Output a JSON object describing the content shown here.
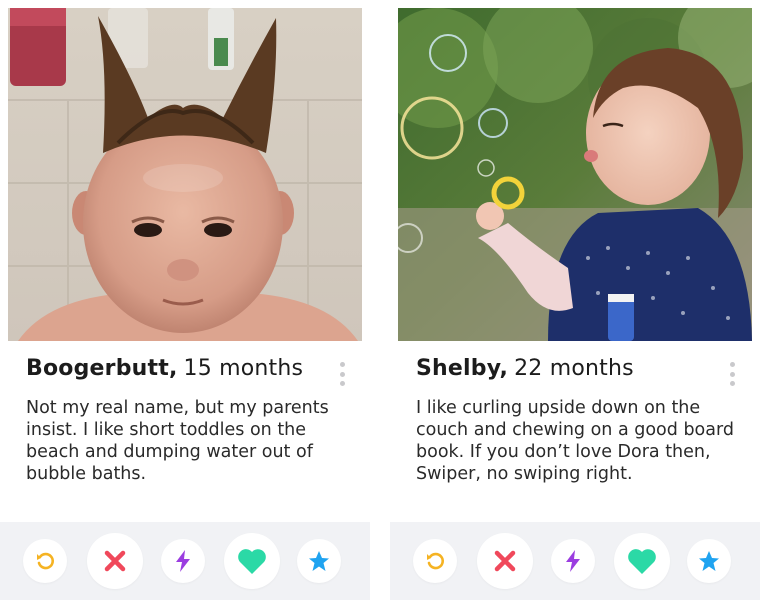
{
  "cards": [
    {
      "name": "Boogerbutt,",
      "age": "15 months",
      "bio": "Not my real name, but my parents insist. I like short toddles on the beach and dumping water out of bubble baths.",
      "photo_subject": "wet-haired-baby"
    },
    {
      "name": "Shelby,",
      "age": "22 months",
      "bio": "I like curling upside down on the couch and chewing on a good board book. If you don’t love Dora then, Swiper, no swiping right.",
      "photo_subject": "girl-blowing-bubbles"
    }
  ],
  "actions": [
    {
      "icon": "rewind-icon",
      "color": "#f5b323"
    },
    {
      "icon": "nope-icon",
      "color": "#f0485b"
    },
    {
      "icon": "boost-icon",
      "color": "#9b3de0"
    },
    {
      "icon": "like-icon",
      "color": "#2bd9a6"
    },
    {
      "icon": "super-like-icon",
      "color": "#1fa3f0"
    }
  ],
  "colors": {
    "action_bar_bg": "#f1f2f5",
    "more_dots": "#c9c9cc",
    "text": "#1c1c1c"
  }
}
